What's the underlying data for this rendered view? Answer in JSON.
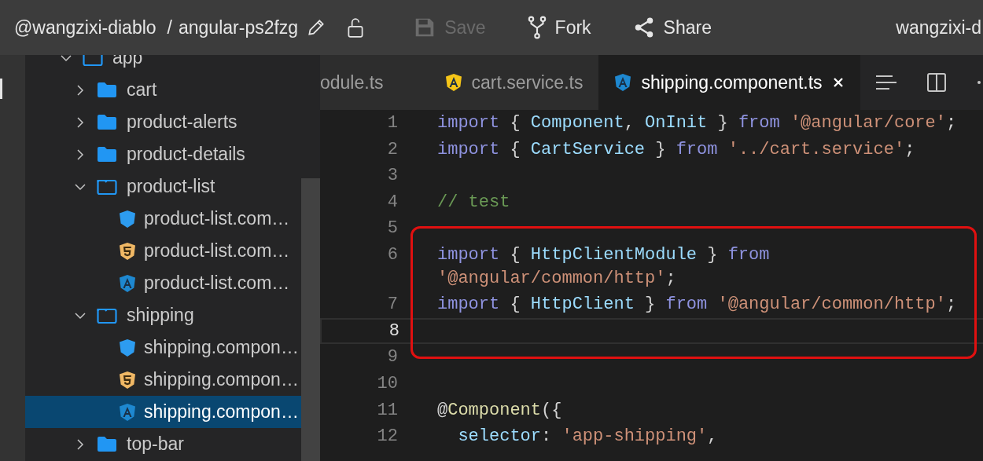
{
  "top_bar": {
    "owner": "@wangzixi-diablo",
    "separator": "/",
    "project": "angular-ps2fzg",
    "actions": [
      {
        "kind": "save",
        "label": "Save",
        "disabled": true
      },
      {
        "kind": "fork",
        "label": "Fork",
        "disabled": false
      },
      {
        "kind": "share",
        "label": "Share",
        "disabled": false
      }
    ],
    "user": "wangzixi-d"
  },
  "file_tree": [
    {
      "name": "app",
      "kind": "folder",
      "expanded": true,
      "selected": false,
      "children": [
        {
          "name": "cart",
          "kind": "folder",
          "expanded": false,
          "selected": false
        },
        {
          "name": "product-alerts",
          "kind": "folder",
          "expanded": false,
          "selected": false
        },
        {
          "name": "product-details",
          "kind": "folder",
          "expanded": false,
          "selected": false
        },
        {
          "name": "product-list",
          "kind": "folder",
          "expanded": true,
          "selected": false,
          "children": [
            {
              "name": "product-list.com…",
              "kind": "css",
              "selected": false
            },
            {
              "name": "product-list.com…",
              "kind": "html",
              "selected": false
            },
            {
              "name": "product-list.com…",
              "kind": "angular",
              "selected": false
            }
          ]
        },
        {
          "name": "shipping",
          "kind": "folder",
          "expanded": true,
          "selected": false,
          "children": [
            {
              "name": "shipping.compon…",
              "kind": "css",
              "selected": false
            },
            {
              "name": "shipping.compon…",
              "kind": "html",
              "selected": false
            },
            {
              "name": "shipping.compon…",
              "kind": "angular",
              "selected": true
            }
          ]
        },
        {
          "name": "top-bar",
          "kind": "folder",
          "expanded": false,
          "selected": false
        }
      ]
    }
  ],
  "tabs": [
    {
      "label": "odule.ts",
      "kind": "plain",
      "selected": false
    },
    {
      "label": "cart.service.ts",
      "kind": "service",
      "selected": false
    },
    {
      "label": "shipping.component.ts",
      "kind": "component",
      "selected": true
    }
  ],
  "code_lines": [
    {
      "number": "1",
      "current": false,
      "boxed": false,
      "visual_lines": [
        {
          "runs": [
            {
              "kind": "kw",
              "text": "import"
            },
            {
              "kind": "p",
              "text": " { "
            },
            {
              "kind": "id",
              "text": "Component"
            },
            {
              "kind": "p",
              "text": ", "
            },
            {
              "kind": "id",
              "text": "OnInit"
            },
            {
              "kind": "p",
              "text": " } "
            },
            {
              "kind": "kw",
              "text": "from"
            },
            {
              "kind": "str",
              "text": " '@angular/core'"
            },
            {
              "kind": "p",
              "text": ";"
            }
          ]
        }
      ]
    },
    {
      "number": "2",
      "current": false,
      "boxed": false,
      "visual_lines": [
        {
          "runs": [
            {
              "kind": "kw",
              "text": "import"
            },
            {
              "kind": "p",
              "text": " { "
            },
            {
              "kind": "id",
              "text": "CartService"
            },
            {
              "kind": "p",
              "text": " } "
            },
            {
              "kind": "kw",
              "text": "from"
            },
            {
              "kind": "str",
              "text": " '../cart.service'"
            },
            {
              "kind": "p",
              "text": ";"
            }
          ]
        }
      ]
    },
    {
      "number": "3",
      "current": false,
      "boxed": false
    },
    {
      "number": "4",
      "current": false,
      "boxed": false,
      "visual_lines": [
        {
          "runs": [
            {
              "kind": "cm",
              "text": "// test"
            }
          ]
        }
      ]
    },
    {
      "number": "5",
      "current": false,
      "boxed": false
    },
    {
      "number": "6",
      "current": false,
      "boxed": true,
      "visual_lines": [
        {
          "runs": [
            {
              "kind": "kw",
              "text": "import"
            },
            {
              "kind": "p",
              "text": " { "
            },
            {
              "kind": "id",
              "text": "HttpClientModule"
            },
            {
              "kind": "p",
              "text": " } "
            },
            {
              "kind": "kw",
              "text": "from"
            }
          ]
        },
        {
          "runs": [
            {
              "kind": "str",
              "text": "'@angular/common/http'"
            },
            {
              "kind": "p",
              "text": ";"
            }
          ]
        }
      ]
    },
    {
      "number": "7",
      "current": false,
      "boxed": true,
      "visual_lines": [
        {
          "runs": [
            {
              "kind": "kw",
              "text": "import"
            },
            {
              "kind": "p",
              "text": " { "
            },
            {
              "kind": "id",
              "text": "HttpClient"
            },
            {
              "kind": "p",
              "text": " } "
            },
            {
              "kind": "kw",
              "text": "from"
            },
            {
              "kind": "str",
              "text": " '@angular/common/http'"
            },
            {
              "kind": "p",
              "text": ";"
            }
          ]
        }
      ]
    },
    {
      "number": "8",
      "current": true,
      "boxed": true
    },
    {
      "number": "9",
      "current": false,
      "boxed": false
    },
    {
      "number": "10",
      "current": false,
      "boxed": false
    },
    {
      "number": "11",
      "current": false,
      "boxed": false,
      "visual_lines": [
        {
          "runs": [
            {
              "kind": "p",
              "text": "@"
            },
            {
              "kind": "fn",
              "text": "Component"
            },
            {
              "kind": "p",
              "text": "({"
            }
          ]
        }
      ]
    },
    {
      "number": "12",
      "current": false,
      "boxed": false,
      "visual_lines": [
        {
          "runs": [
            {
              "kind": "id",
              "text": "  selector"
            },
            {
              "kind": "p",
              "text": ": "
            },
            {
              "kind": "str",
              "text": "'app-shipping'"
            },
            {
              "kind": "p",
              "text": ","
            }
          ]
        }
      ]
    }
  ]
}
